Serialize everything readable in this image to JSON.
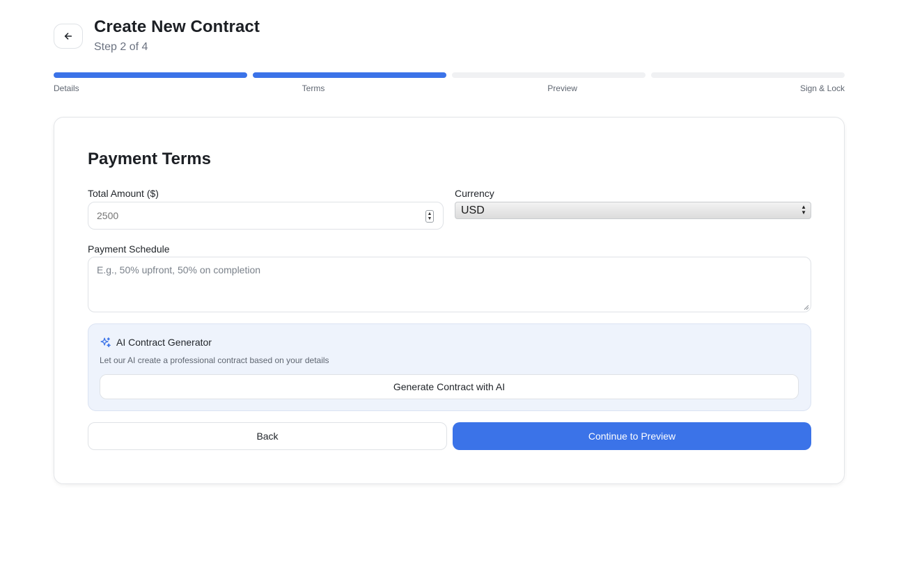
{
  "header": {
    "title": "Create New Contract",
    "subtitle": "Step 2 of 4",
    "back_icon": "arrow-left-icon"
  },
  "progress": {
    "current_step": 2,
    "total_steps": 4,
    "steps": [
      {
        "label": "Details",
        "completed": true
      },
      {
        "label": "Terms",
        "completed": true
      },
      {
        "label": "Preview",
        "completed": false
      },
      {
        "label": "Sign & Lock",
        "completed": false
      }
    ],
    "colors": {
      "completed": "#3b73e8",
      "pending": "#f0f1f3"
    }
  },
  "form": {
    "section_title": "Payment Terms",
    "total_amount": {
      "label": "Total Amount ($)",
      "value": "",
      "placeholder": "2500"
    },
    "currency": {
      "label": "Currency",
      "selected": "USD"
    },
    "payment_schedule": {
      "label": "Payment Schedule",
      "value": "",
      "placeholder": "E.g., 50% upfront, 50% on completion"
    }
  },
  "ai_generator": {
    "icon": "sparkles-icon",
    "title": "AI Contract Generator",
    "description": "Let our AI create a professional contract based on your details",
    "button_label": "Generate Contract with AI"
  },
  "actions": {
    "back_label": "Back",
    "continue_label": "Continue to Preview"
  },
  "colors": {
    "accent": "#3b73e8",
    "ai_box_background": "#eef3fc"
  }
}
